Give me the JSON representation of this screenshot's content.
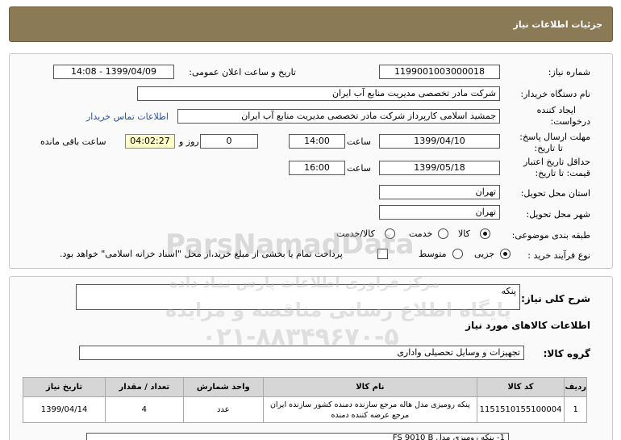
{
  "header": {
    "title": "جزئیات اطلاعات نیاز"
  },
  "form": {
    "need_number_label": "شماره نیاز:",
    "need_number": "1199001003000018",
    "announce_label": "تاریخ و ساعت اعلان عمومی:",
    "announce_value": "1399/04/09 - 14:08",
    "buyer_label": "نام دستگاه خریدار:",
    "buyer_value": "شرکت مادر تخصصی مدیریت منابع آب ایران",
    "creator_label_1": "ایجاد کننده",
    "creator_label_2": "درخواست:",
    "creator_value": "جمشید  اسلامی کارپرداز شرکت مادر تخصصی مدیریت منابع آب ایران",
    "contact_link": "اطلاعات تماس خریدار",
    "deadline_label_1": "مهلت ارسال پاسخ:",
    "deadline_label_2": "تا تاریخ:",
    "deadline_date": "1399/04/10",
    "time_label": "ساعت",
    "deadline_time": "14:00",
    "days_value": "0",
    "days_label": "روز و",
    "remaining_time": "04:02:27",
    "remaining_label": "ساعت باقی مانده",
    "validity_label_1": "حداقل تاریخ اعتبار",
    "validity_label_2": "قیمت: تا تاریخ:",
    "validity_date": "1399/05/18",
    "validity_time": "16:00",
    "province_label": "استان محل تحویل:",
    "province_value": "تهران",
    "city_label": "شهر محل تحویل:",
    "city_value": "تهران",
    "category_label": "طبقه بندی موضوعی:",
    "category_options": [
      "کالا",
      "خدمت",
      "کالا/خدمت"
    ],
    "category_selected": "کالا",
    "process_label": "نوع فرآیند خرید :",
    "process_options": [
      "جزیی",
      "متوسط"
    ],
    "process_selected": "جزیی",
    "payment_note": "پرداخت تمام یا بخشی از مبلغ خرید،از محل \"اسناد خزانه اسلامی\" خواهد بود."
  },
  "summary": {
    "desc_label": "شرح کلی نیاز:",
    "desc_value": "پنکه",
    "goods_info_title": "اطلاعات کالاهای مورد نیاز",
    "group_label": "گروه کالا:",
    "group_value": "تجهیزات و وسایل تحصیلی واداری"
  },
  "table": {
    "headers": [
      "ردیف",
      "کد کالا",
      "نام کالا",
      "واحد شمارش",
      "تعداد / مقدار",
      "تاریخ نیاز"
    ],
    "rows": [
      [
        "1",
        "1151510155100004",
        "پنکه رومیزی مدل هاله مرجع سازنده دمنده کشور سازنده ایران مرجع عرضه کننده دمنده",
        "عدد",
        "4",
        "1399/04/14"
      ]
    ]
  },
  "bottom_note": "1- پنکه رومیزی مدل FS 9010 B",
  "watermark": {
    "line1": "ParsNamadData",
    "line2": "مرکز فراوری اطلاعات پارس نماد داده",
    "line3": "پایگاه اطلاع رسانی مناقصه و مزایده",
    "line4": "۰۲۱-۸۸۳۴۹۶۷۰-۵"
  }
}
